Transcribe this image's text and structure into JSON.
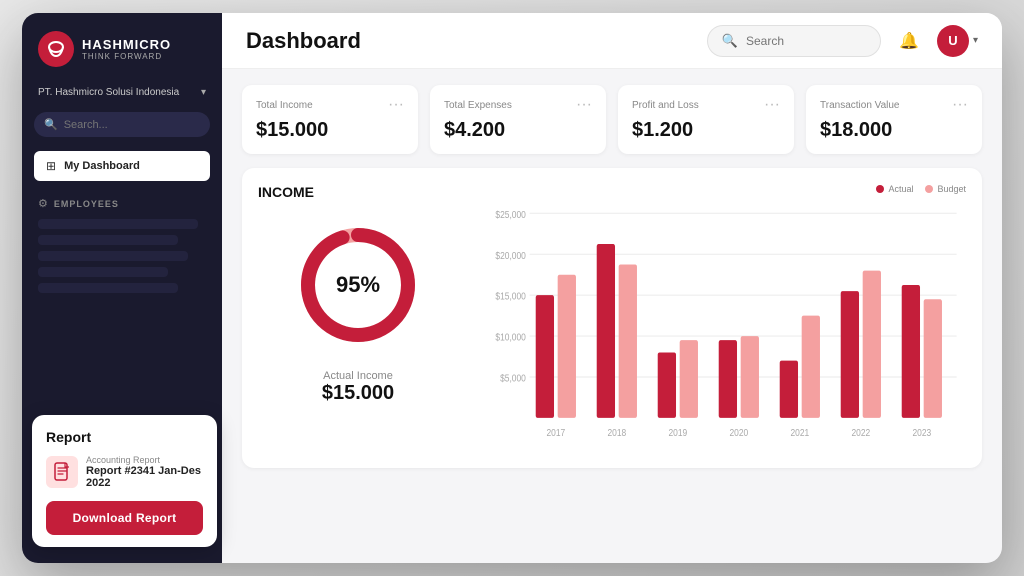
{
  "app": {
    "title": "Dashboard",
    "search_placeholder": "Search"
  },
  "sidebar": {
    "logo_brand": "HASHMICRO",
    "logo_tagline": "THINK FORWARD",
    "company_name": "PT. Hashmicro Solusi Indonesia",
    "search_placeholder": "Search...",
    "my_dashboard_label": "My Dashboard",
    "employees_section_label": "EMPLOYEES"
  },
  "report_card": {
    "title": "Report",
    "file_type": "Accounting Report",
    "file_name": "Report #2341 Jan-Des 2022",
    "download_button_label": "Download Report"
  },
  "metrics": [
    {
      "label": "Total Income",
      "value": "$15.000"
    },
    {
      "label": "Total Expenses",
      "value": "$4.200"
    },
    {
      "label": "Profit and Loss",
      "value": "$1.200"
    },
    {
      "label": "Transaction Value",
      "value": "$18.000"
    }
  ],
  "income_chart": {
    "title": "INCOME",
    "donut_percent": "95%",
    "actual_income_label": "Actual Income",
    "actual_income_value": "$15.000",
    "legend_actual": "Actual",
    "legend_budget": "Budget",
    "chart_colors": {
      "actual": "#c41e3a",
      "budget": "#f4a0a0",
      "donut_primary": "#c41e3a",
      "donut_secondary": "#f4a0a0",
      "donut_track": "#f0f0f0"
    },
    "years": [
      "2017",
      "2018",
      "2019",
      "2020",
      "2021",
      "2022",
      "2023"
    ],
    "y_labels": [
      "$25,000",
      "$20,000",
      "$15,000",
      "$10,000",
      "$5000",
      ""
    ],
    "bars": [
      {
        "year": "2017",
        "actual": 60,
        "budget": 70
      },
      {
        "year": "2018",
        "actual": 85,
        "budget": 75
      },
      {
        "year": "2019",
        "actual": 32,
        "budget": 38
      },
      {
        "year": "2020",
        "actual": 38,
        "budget": 40
      },
      {
        "year": "2021",
        "actual": 28,
        "budget": 50
      },
      {
        "year": "2022",
        "actual": 62,
        "budget": 72
      },
      {
        "year": "2023",
        "actual": 65,
        "budget": 58
      }
    ]
  }
}
